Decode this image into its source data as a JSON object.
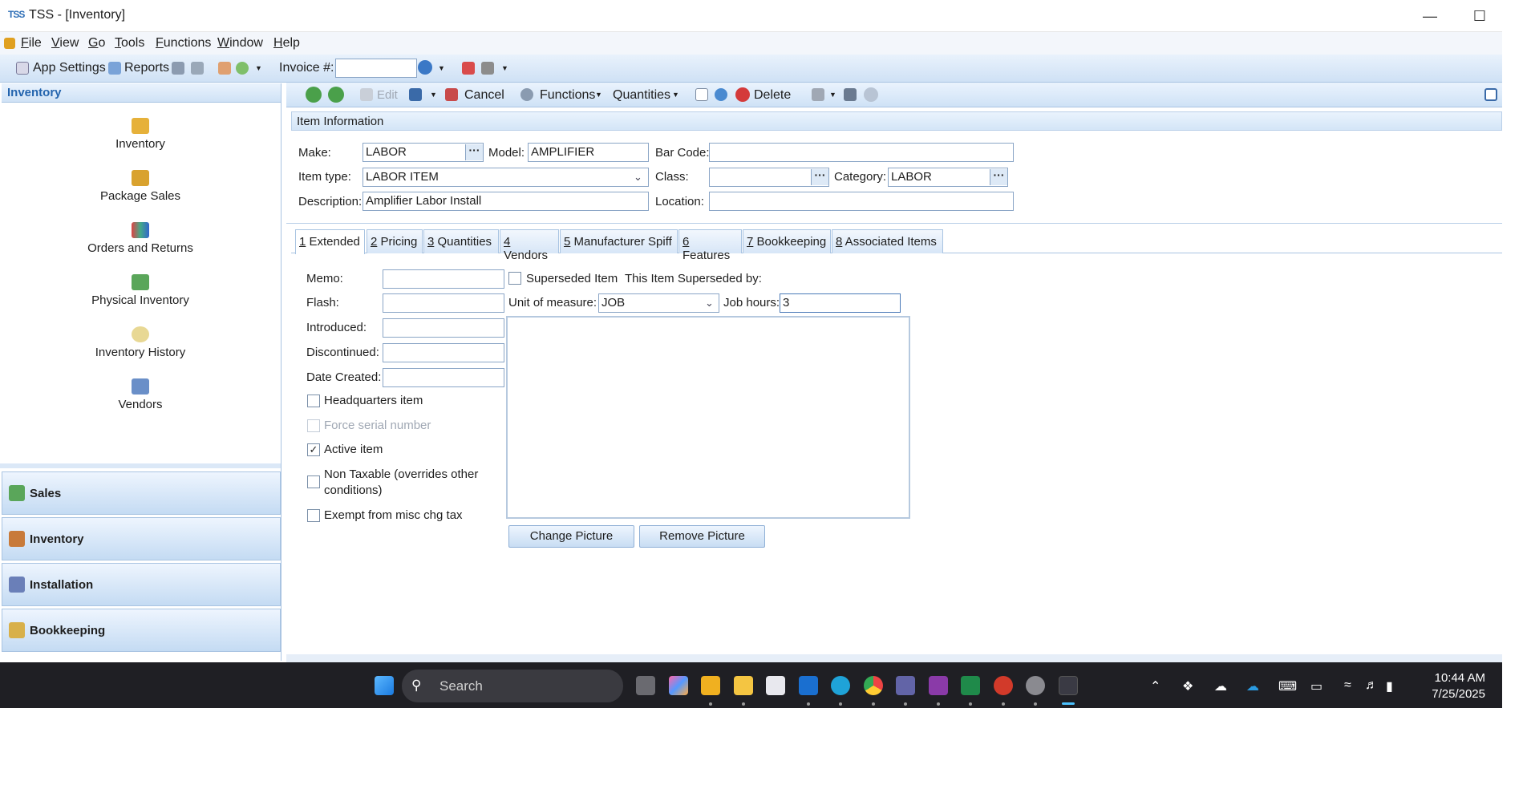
{
  "window": {
    "logo": "TSS",
    "title": "TSS - [Inventory]"
  },
  "menu": [
    {
      "label": "File",
      "key": "F"
    },
    {
      "label": "View",
      "key": "V"
    },
    {
      "label": "Go",
      "key": "G"
    },
    {
      "label": "Tools",
      "key": "T"
    },
    {
      "label": "Functions",
      "key": "F"
    },
    {
      "label": "Window",
      "key": "W"
    },
    {
      "label": "Help",
      "key": "H"
    }
  ],
  "toolbar": {
    "app_settings": "App Settings",
    "reports": "Reports",
    "invoice_label": "Invoice #:",
    "invoice_value": ""
  },
  "left_panel": {
    "header": "Inventory",
    "items": [
      "Inventory",
      "Package Sales",
      "Orders and Returns",
      "Physical Inventory",
      "Inventory History",
      "Vendors"
    ],
    "sections": [
      "Sales",
      "Inventory",
      "Installation",
      "Bookkeeping"
    ]
  },
  "content_toolbar": {
    "edit": "Edit",
    "cancel": "Cancel",
    "functions": "Functions",
    "quantities": "Quantities",
    "delete": "Delete"
  },
  "item_info": {
    "header": "Item Information",
    "make_label": "Make:",
    "make": "LABOR",
    "model_label": "Model:",
    "model": "AMPLIFIER",
    "barcode_label": "Bar Code:",
    "barcode": "",
    "itemtype_label": "Item type:",
    "itemtype": "LABOR ITEM",
    "class_label": "Class:",
    "class": "",
    "category_label": "Category:",
    "category": "LABOR",
    "description_label": "Description:",
    "description": "Amplifier Labor Install",
    "location_label": "Location:",
    "location": ""
  },
  "tabs": [
    {
      "num": "1",
      "label": " Extended"
    },
    {
      "num": "2",
      "label": " Pricing"
    },
    {
      "num": "3",
      "label": " Quantities"
    },
    {
      "num": "4",
      "label": " Vendors"
    },
    {
      "num": "5",
      "label": " Manufacturer Spiff"
    },
    {
      "num": "6",
      "label": " Features"
    },
    {
      "num": "7",
      "label": " Bookkeeping"
    },
    {
      "num": "8",
      "label": " Associated Items"
    }
  ],
  "extended": {
    "memo_label": "Memo:",
    "memo": "",
    "flash_label": "Flash:",
    "flash": "",
    "introduced_label": "Introduced:",
    "introduced": "",
    "discontinued_label": "Discontinued:",
    "discontinued": "",
    "date_created_label": "Date Created:",
    "date_created": "",
    "superseded_label": "Superseded Item",
    "superseded_by_label": "This Item Superseded by:",
    "uom_label": "Unit of measure:",
    "uom": "JOB",
    "job_hours_label": "Job hours:",
    "job_hours": "3",
    "headquarters": "Headquarters item",
    "force_serial": "Force serial number",
    "active": "Active item",
    "non_taxable_1": "Non Taxable (overrides other",
    "non_taxable_2": "conditions)",
    "exempt": "Exempt from misc chg tax",
    "change_picture": "Change Picture",
    "remove_picture": "Remove Picture"
  },
  "checks": {
    "superseded": false,
    "headquarters": false,
    "force_serial": false,
    "active": true,
    "non_taxable": false,
    "exempt": false
  },
  "taskbar": {
    "search_placeholder": "Search",
    "time": "10:44 AM",
    "date": "7/25/2025"
  },
  "colors": {
    "accent": "#2364ae",
    "panel": "#cfe2f6",
    "taskbar": "#1f1f24"
  }
}
